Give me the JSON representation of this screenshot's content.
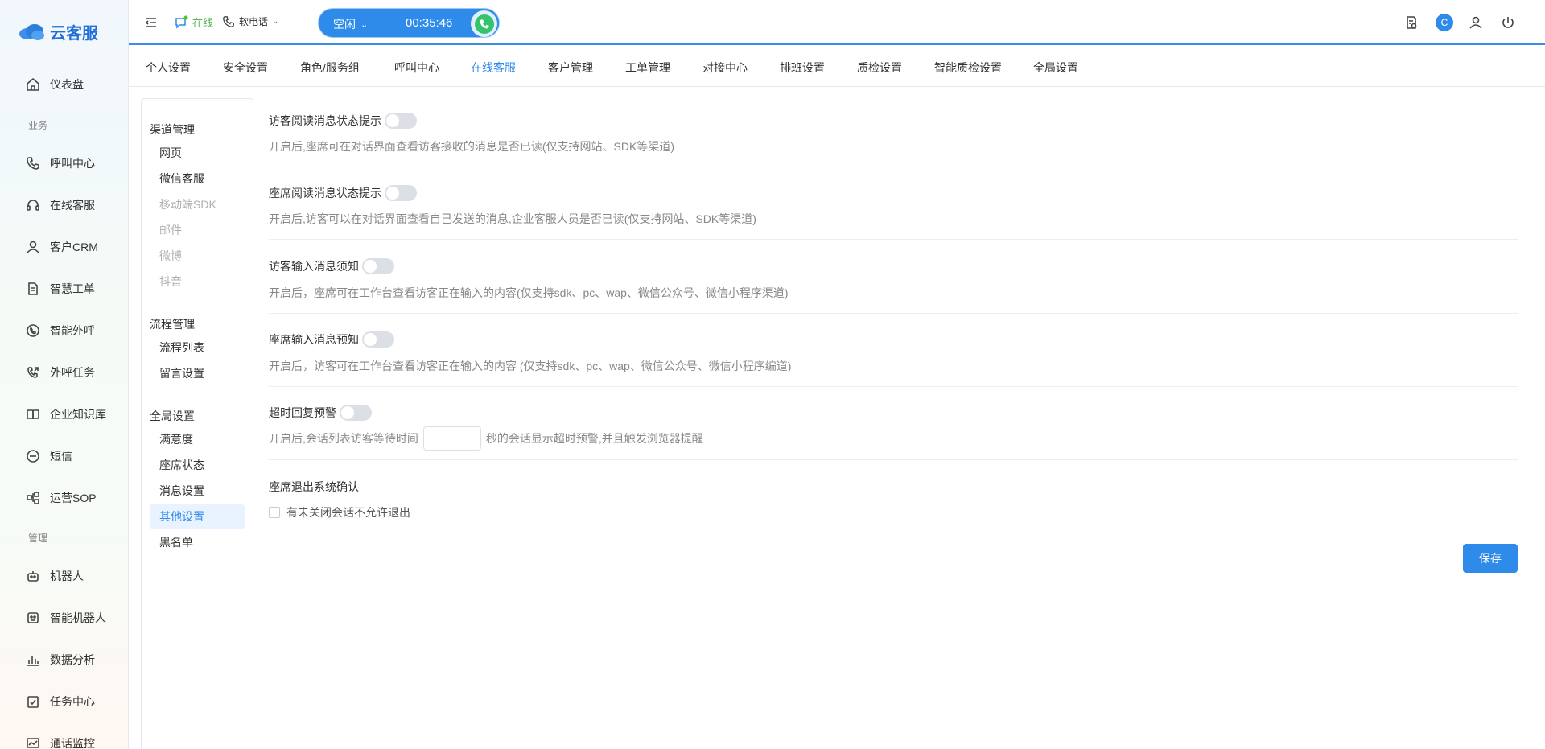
{
  "app": {
    "logo_text": "云客服"
  },
  "sidebar": {
    "items": [
      {
        "label": "仪表盘",
        "icon": "home-icon"
      },
      {
        "group": "业务"
      },
      {
        "label": "呼叫中心",
        "icon": "phone-icon"
      },
      {
        "label": "在线客服",
        "icon": "headset-icon"
      },
      {
        "label": "客户CRM",
        "icon": "user-icon"
      },
      {
        "label": "智慧工单",
        "icon": "document-icon"
      },
      {
        "label": "智能外呼",
        "icon": "chat-phone-icon"
      },
      {
        "label": "外呼任务",
        "icon": "phone-out-icon"
      },
      {
        "label": "企业知识库",
        "icon": "book-icon"
      },
      {
        "label": "短信",
        "icon": "sms-icon"
      },
      {
        "label": "运营SOP",
        "icon": "flow-icon"
      },
      {
        "group": "管理"
      },
      {
        "label": "机器人",
        "icon": "robot-icon"
      },
      {
        "label": "智能机器人",
        "icon": "smart-robot-icon"
      },
      {
        "label": "数据分析",
        "icon": "chart-icon"
      },
      {
        "label": "任务中心",
        "icon": "task-icon"
      },
      {
        "label": "通话监控",
        "icon": "monitor-icon"
      }
    ]
  },
  "topbar": {
    "status": "在线",
    "phone_mode": "软电话",
    "call_status": "空闲",
    "timer": "00:35:46",
    "avatar_letter": "C"
  },
  "tabs": [
    {
      "label": "个人设置"
    },
    {
      "label": "安全设置"
    },
    {
      "label": "角色/服务组"
    },
    {
      "label": "呼叫中心"
    },
    {
      "label": "在线客服",
      "active": true
    },
    {
      "label": "客户管理"
    },
    {
      "label": "工单管理"
    },
    {
      "label": "对接中心"
    },
    {
      "label": "排班设置"
    },
    {
      "label": "质检设置"
    },
    {
      "label": "智能质检设置"
    },
    {
      "label": "全局设置"
    }
  ],
  "subnav": {
    "group1": "渠道管理",
    "group1_items": [
      "网页",
      "微信客服",
      "移动端SDK",
      "邮件",
      "微博",
      "抖音"
    ],
    "group2": "流程管理",
    "group2_items": [
      "流程列表",
      "留言设置"
    ],
    "group3": "全局设置",
    "group3_items": [
      "满意度",
      "座席状态",
      "消息设置",
      "其他设置",
      "黑名单"
    ]
  },
  "settings": {
    "s1_title": "访客阅读消息状态提示",
    "s1_desc": "开启后,座席可在对话界面查看访客接收的消息是否已读(仅支持网站、SDK等渠道)",
    "s2_title": "座席阅读消息状态提示",
    "s2_desc": "开启后,访客可以在对话界面查看自己发送的消息,企业客服人员是否已读(仅支持网站、SDK等渠道)",
    "s3_title": "访客输入消息须知",
    "s3_desc": "开启后，座席可在工作台查看访客正在输入的内容(仅支持sdk、pc、wap、微信公众号、微信小程序渠道)",
    "s4_title": "座席输入消息预知",
    "s4_desc": "开启后，访客可在工作台查看访客正在输入的内容 (仅支持sdk、pc、wap、微信公众号、微信小程序编道)",
    "s5_title": "超时回复预警",
    "s5_desc_before": "开启后,会话列表访客等待时间",
    "s5_desc_after": "秒的会话显示超时预警,并且触发浏览器提醒",
    "s6_title": "座席退出系统确认",
    "s6_checkbox": "有未关闭会话不允许退出"
  },
  "save_label": "保存"
}
